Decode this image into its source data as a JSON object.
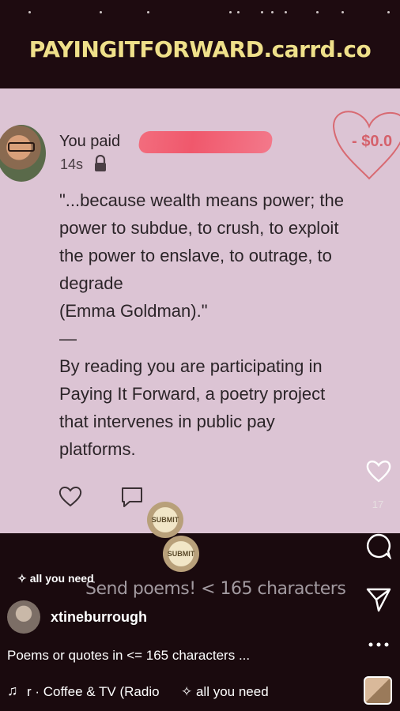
{
  "brand": {
    "title": "PAYINGITFORWARD.carrd.co"
  },
  "post": {
    "paid_text": "You paid",
    "amount": "- $0.0",
    "timestamp": "14s",
    "quote": "\"...because wealth means power; the\npower to subdue, to crush, to exploit\nthe power to enslave, to outrage, to\ndegrade\n(Emma Goldman).\"\n—\nBy reading you are participating in\nPaying It Forward, a poetry project\nthat intervenes in public pay\nplatforms."
  },
  "stickers": {
    "submit_label": "SUBMIT",
    "text": "Send poems! < 165 characters"
  },
  "rail": {
    "likes": "17"
  },
  "reel": {
    "tag": "all you need",
    "username": "xtineburrough",
    "caption": "Poems or quotes in <= 165 characters ...",
    "song": "r · Coffee & TV (Radio",
    "song_tag": "all you need"
  },
  "icons": [
    "heart-icon",
    "comment-icon",
    "share-icon",
    "more-icon",
    "lock-icon",
    "music-icon",
    "sparkle-icon"
  ]
}
